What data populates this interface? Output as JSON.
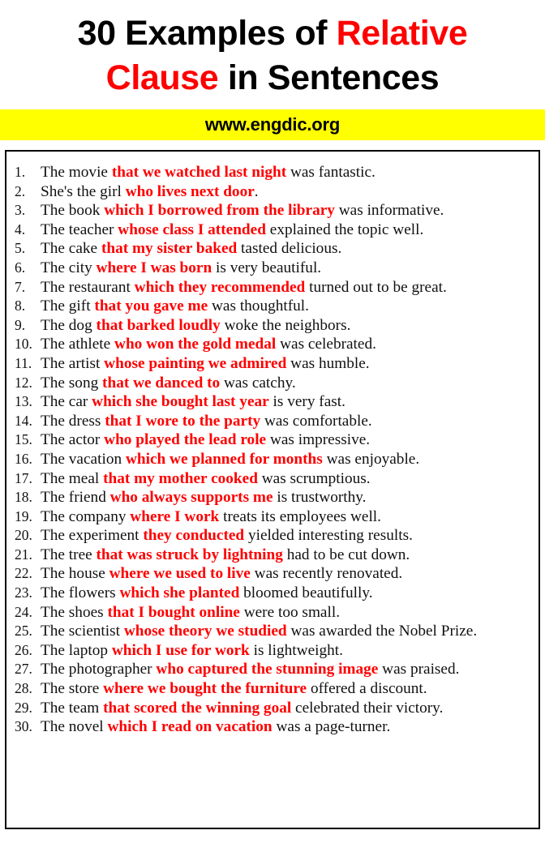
{
  "title": {
    "line1_part1": "30 Examples of ",
    "line1_highlight": "Relative",
    "line2_highlight": "Clause",
    "line2_part2": " in Sentences",
    "highlight_color": "#FF0000",
    "text_color": "#000000"
  },
  "banner": {
    "text": "www.engdic.org",
    "background_color": "#FFFF00",
    "text_color": "#000000"
  },
  "list": {
    "highlight_color": "#FF0000",
    "items": [
      {
        "num": "1.",
        "pre": "The movie ",
        "hl": "that we watched last night",
        "post": " was fantastic."
      },
      {
        "num": "2.",
        "pre": "She's the girl ",
        "hl": "who lives next door",
        "post": "."
      },
      {
        "num": "3.",
        "pre": "The book ",
        "hl": "which I borrowed from the library",
        "post": " was informative."
      },
      {
        "num": "4.",
        "pre": "The teacher ",
        "hl": "whose class I attended",
        "post": " explained the topic well."
      },
      {
        "num": "5.",
        "pre": "The cake ",
        "hl": "that my sister baked",
        "post": " tasted delicious."
      },
      {
        "num": "6.",
        "pre": "The city ",
        "hl": "where I was born",
        "post": " is very beautiful."
      },
      {
        "num": "7.",
        "pre": "The restaurant ",
        "hl": "which they recommended",
        "post": " turned out to be great."
      },
      {
        "num": "8.",
        "pre": "The gift ",
        "hl": "that you gave me",
        "post": " was thoughtful."
      },
      {
        "num": "9.",
        "pre": "The dog ",
        "hl": "that barked loudly",
        "post": " woke the neighbors."
      },
      {
        "num": "10.",
        "pre": "The athlete ",
        "hl": "who won the gold medal",
        "post": " was celebrated."
      },
      {
        "num": "11.",
        "pre": "The artist ",
        "hl": "whose painting we admired",
        "post": " was humble."
      },
      {
        "num": "12.",
        "pre": "The song ",
        "hl": "that we danced to",
        "post": " was catchy."
      },
      {
        "num": "13.",
        "pre": "The car ",
        "hl": "which she bought last year",
        "post": " is very fast."
      },
      {
        "num": "14.",
        "pre": "The dress ",
        "hl": "that I wore to the party",
        "post": " was comfortable."
      },
      {
        "num": "15.",
        "pre": "The actor ",
        "hl": "who played the lead role",
        "post": " was impressive."
      },
      {
        "num": "16.",
        "pre": "The vacation ",
        "hl": "which we planned for months",
        "post": " was enjoyable."
      },
      {
        "num": "17.",
        "pre": "The meal ",
        "hl": "that my mother cooked",
        "post": "  was scrumptious."
      },
      {
        "num": "18.",
        "pre": "The friend ",
        "hl": "who always supports me",
        "post": " is trustworthy."
      },
      {
        "num": "19.",
        "pre": "The company ",
        "hl": "where I work",
        "post": " treats its employees well."
      },
      {
        "num": "20.",
        "pre": "The experiment ",
        "hl": "they conducted",
        "post": " yielded interesting results."
      },
      {
        "num": "21.",
        "pre": "The tree ",
        "hl": "that was struck by lightning",
        "post": " had to be cut down."
      },
      {
        "num": "22.",
        "pre": "The house ",
        "hl": "where we used to live",
        "post": " was recently renovated."
      },
      {
        "num": "23.",
        "pre": "The flowers ",
        "hl": "which she planted",
        "post": " bloomed beautifully."
      },
      {
        "num": "24.",
        "pre": "The shoes ",
        "hl": "that I bought online",
        "post": " were too small."
      },
      {
        "num": "25.",
        "pre": "The scientist ",
        "hl": "whose theory we studied",
        "post": " was awarded the Nobel Prize."
      },
      {
        "num": "26.",
        "pre": "The laptop ",
        "hl": "which I use for work",
        "post": " is lightweight."
      },
      {
        "num": "27.",
        "pre": "The photographer ",
        "hl": "who captured the stunning image",
        "post": " was praised."
      },
      {
        "num": "28.",
        "pre": "The store ",
        "hl": "where we bought the furniture",
        "post": " offered a discount."
      },
      {
        "num": "29.",
        "pre": "The team ",
        "hl": "that scored the winning goal",
        "post": " celebrated their victory."
      },
      {
        "num": "30.",
        "pre": "The novel ",
        "hl": "which I read on vacation",
        "post": " was a page-turner."
      }
    ]
  }
}
